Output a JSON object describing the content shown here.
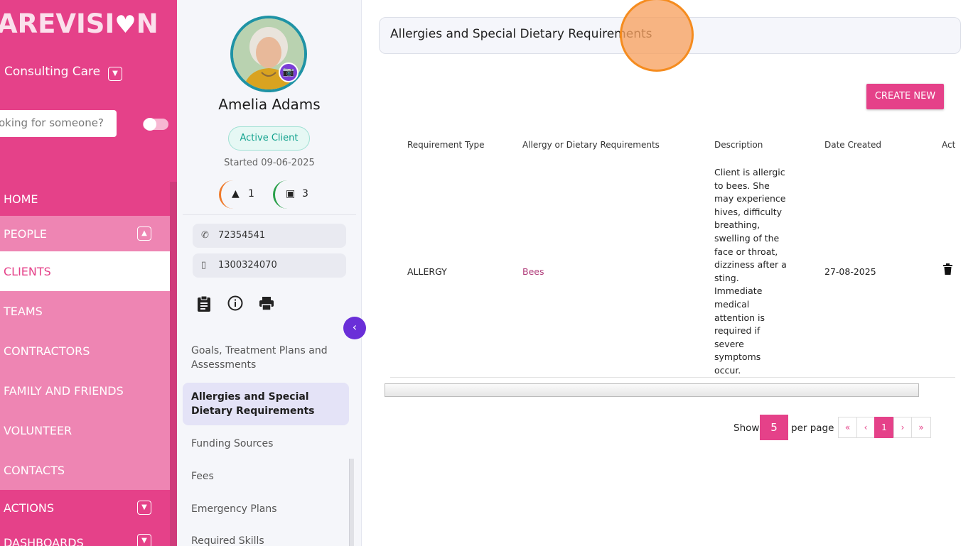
{
  "sidebar": {
    "logo": "AREVISI",
    "logo_heart": "♥",
    "logo_end": "N",
    "organization": "Consulting Care",
    "search_placeholder": "oking for someone?",
    "nav": [
      {
        "label": "HOME"
      },
      {
        "label": "PEOPLE"
      },
      {
        "label": "CLIENTS"
      },
      {
        "label": "TEAMS"
      },
      {
        "label": "CONTRACTORS"
      },
      {
        "label": "FAMILY AND FRIENDS"
      },
      {
        "label": "VOLUNTEER"
      },
      {
        "label": "CONTACTS"
      },
      {
        "label": "ACTIONS"
      },
      {
        "label": "DASHBOARDS"
      }
    ]
  },
  "profile": {
    "name": "Amelia Adams",
    "status": "Active Client",
    "started": "Started 09-06-2025",
    "alerts_count": "1",
    "wallet_count": "3",
    "phone": "72354541",
    "mobile": "1300324070",
    "menu": [
      {
        "label": "Goals, Treatment Plans and Assessments"
      },
      {
        "label": "Allergies and Special Dietary Requirements"
      },
      {
        "label": "Funding Sources"
      },
      {
        "label": "Fees"
      },
      {
        "label": "Emergency Plans"
      },
      {
        "label": "Required Skills"
      }
    ]
  },
  "main": {
    "title": "Allergies and Special Dietary Requirements",
    "create_button": "CREATE NEW",
    "columns": [
      "Requirement Type",
      "Allergy or Dietary Requirements",
      "Description",
      "Date Created",
      "Acti"
    ],
    "rows": [
      {
        "type": "ALLERGY",
        "allergy": "Bees",
        "description": "Client is allergic to bees. She may experience hives, difficulty breathing, swelling of the face or throat, dizziness after a sting. Immediate medical attention is required if severe symptoms occur.",
        "date": "27-08-2025"
      }
    ],
    "pagination": {
      "show_label": "Show",
      "per_page_value": "5",
      "per_page_label": "per page",
      "first": "«",
      "prev": "‹",
      "current": "1",
      "next": "›",
      "last": "»"
    }
  },
  "colors": {
    "brand_pink": "#e54189",
    "accent_purple": "#6a2fd8",
    "status_green": "#12a28e",
    "cursor_orange": "#f58c1f"
  }
}
